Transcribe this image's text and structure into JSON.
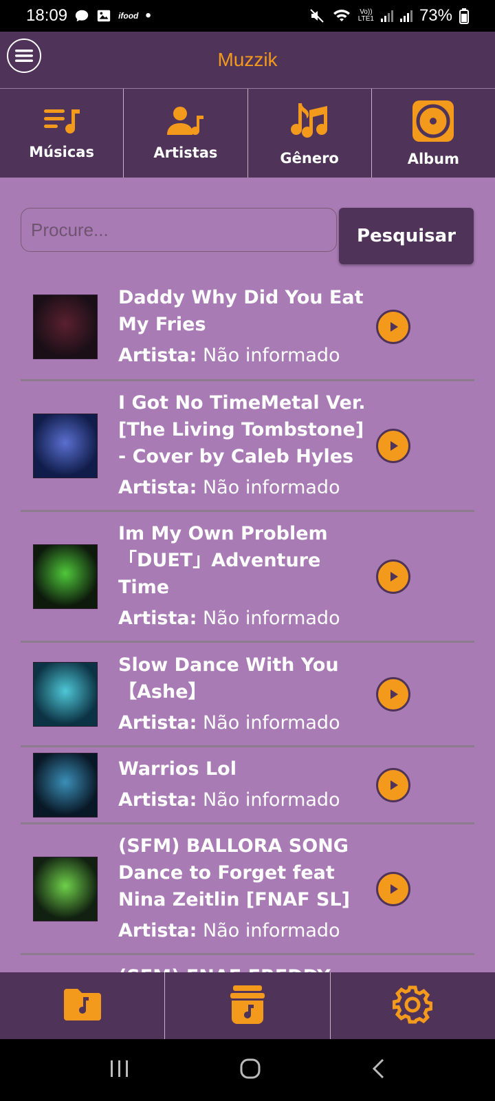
{
  "status_bar": {
    "time": "18:09",
    "ifood_label": "ifood",
    "battery": "73%",
    "lte_top": "Vo))",
    "lte_bottom": "LTE1"
  },
  "header": {
    "title": "Muzzik",
    "menu_icon": "hamburger-menu-icon"
  },
  "categories": [
    {
      "label": "Músicas",
      "icon": "music-list-icon"
    },
    {
      "label": "Artistas",
      "icon": "artist-icon"
    },
    {
      "label": "Gênero",
      "icon": "music-notes-icon"
    },
    {
      "label": "Album",
      "icon": "album-disc-icon"
    }
  ],
  "search": {
    "placeholder": "Procure...",
    "button_label": "Pesquisar"
  },
  "songs": [
    {
      "title": "Daddy Why Did You Eat My Fries",
      "artist_key": "Artista:",
      "artist": "Não informado",
      "thumb_colors": [
        "#1a0f16",
        "#5a2030"
      ]
    },
    {
      "title": "I Got No TimeMetal Ver. [The Living Tombstone] - Cover by Caleb Hyles",
      "artist_key": "Artista:",
      "artist": "Não informado",
      "thumb_colors": [
        "#101d4a",
        "#5a6fd0"
      ]
    },
    {
      "title": "Im My Own Problem 「DUET」Adventure Time",
      "artist_key": "Artista:",
      "artist": "Não informado",
      "thumb_colors": [
        "#0d1a0c",
        "#4fc83a"
      ]
    },
    {
      "title": "Slow Dance With You 【Ashe】",
      "artist_key": "Artista:",
      "artist": "Não informado",
      "thumb_colors": [
        "#0c3344",
        "#4ec7d6"
      ]
    },
    {
      "title": "Warrios Lol",
      "artist_key": "Artista:",
      "artist": "Não informado",
      "thumb_colors": [
        "#091826",
        "#3b8fb8"
      ]
    },
    {
      "title": "(SFM) BALLORA SONG Dance to Forget feat Nina Zeitlin [FNAF SL]",
      "artist_key": "Artista:",
      "artist": "Não informado",
      "thumb_colors": [
        "#112010",
        "#6fd04a"
      ]
    }
  ],
  "partial_song_title": "(SFM) FNAF FREDDY",
  "bottom_nav": [
    {
      "icon": "music-folder-icon"
    },
    {
      "icon": "music-jar-icon"
    },
    {
      "icon": "settings-gear-icon"
    }
  ],
  "colors": {
    "accent": "#f39a1d",
    "header_bg": "#4f3358",
    "content_bg": "#a97bb5"
  }
}
